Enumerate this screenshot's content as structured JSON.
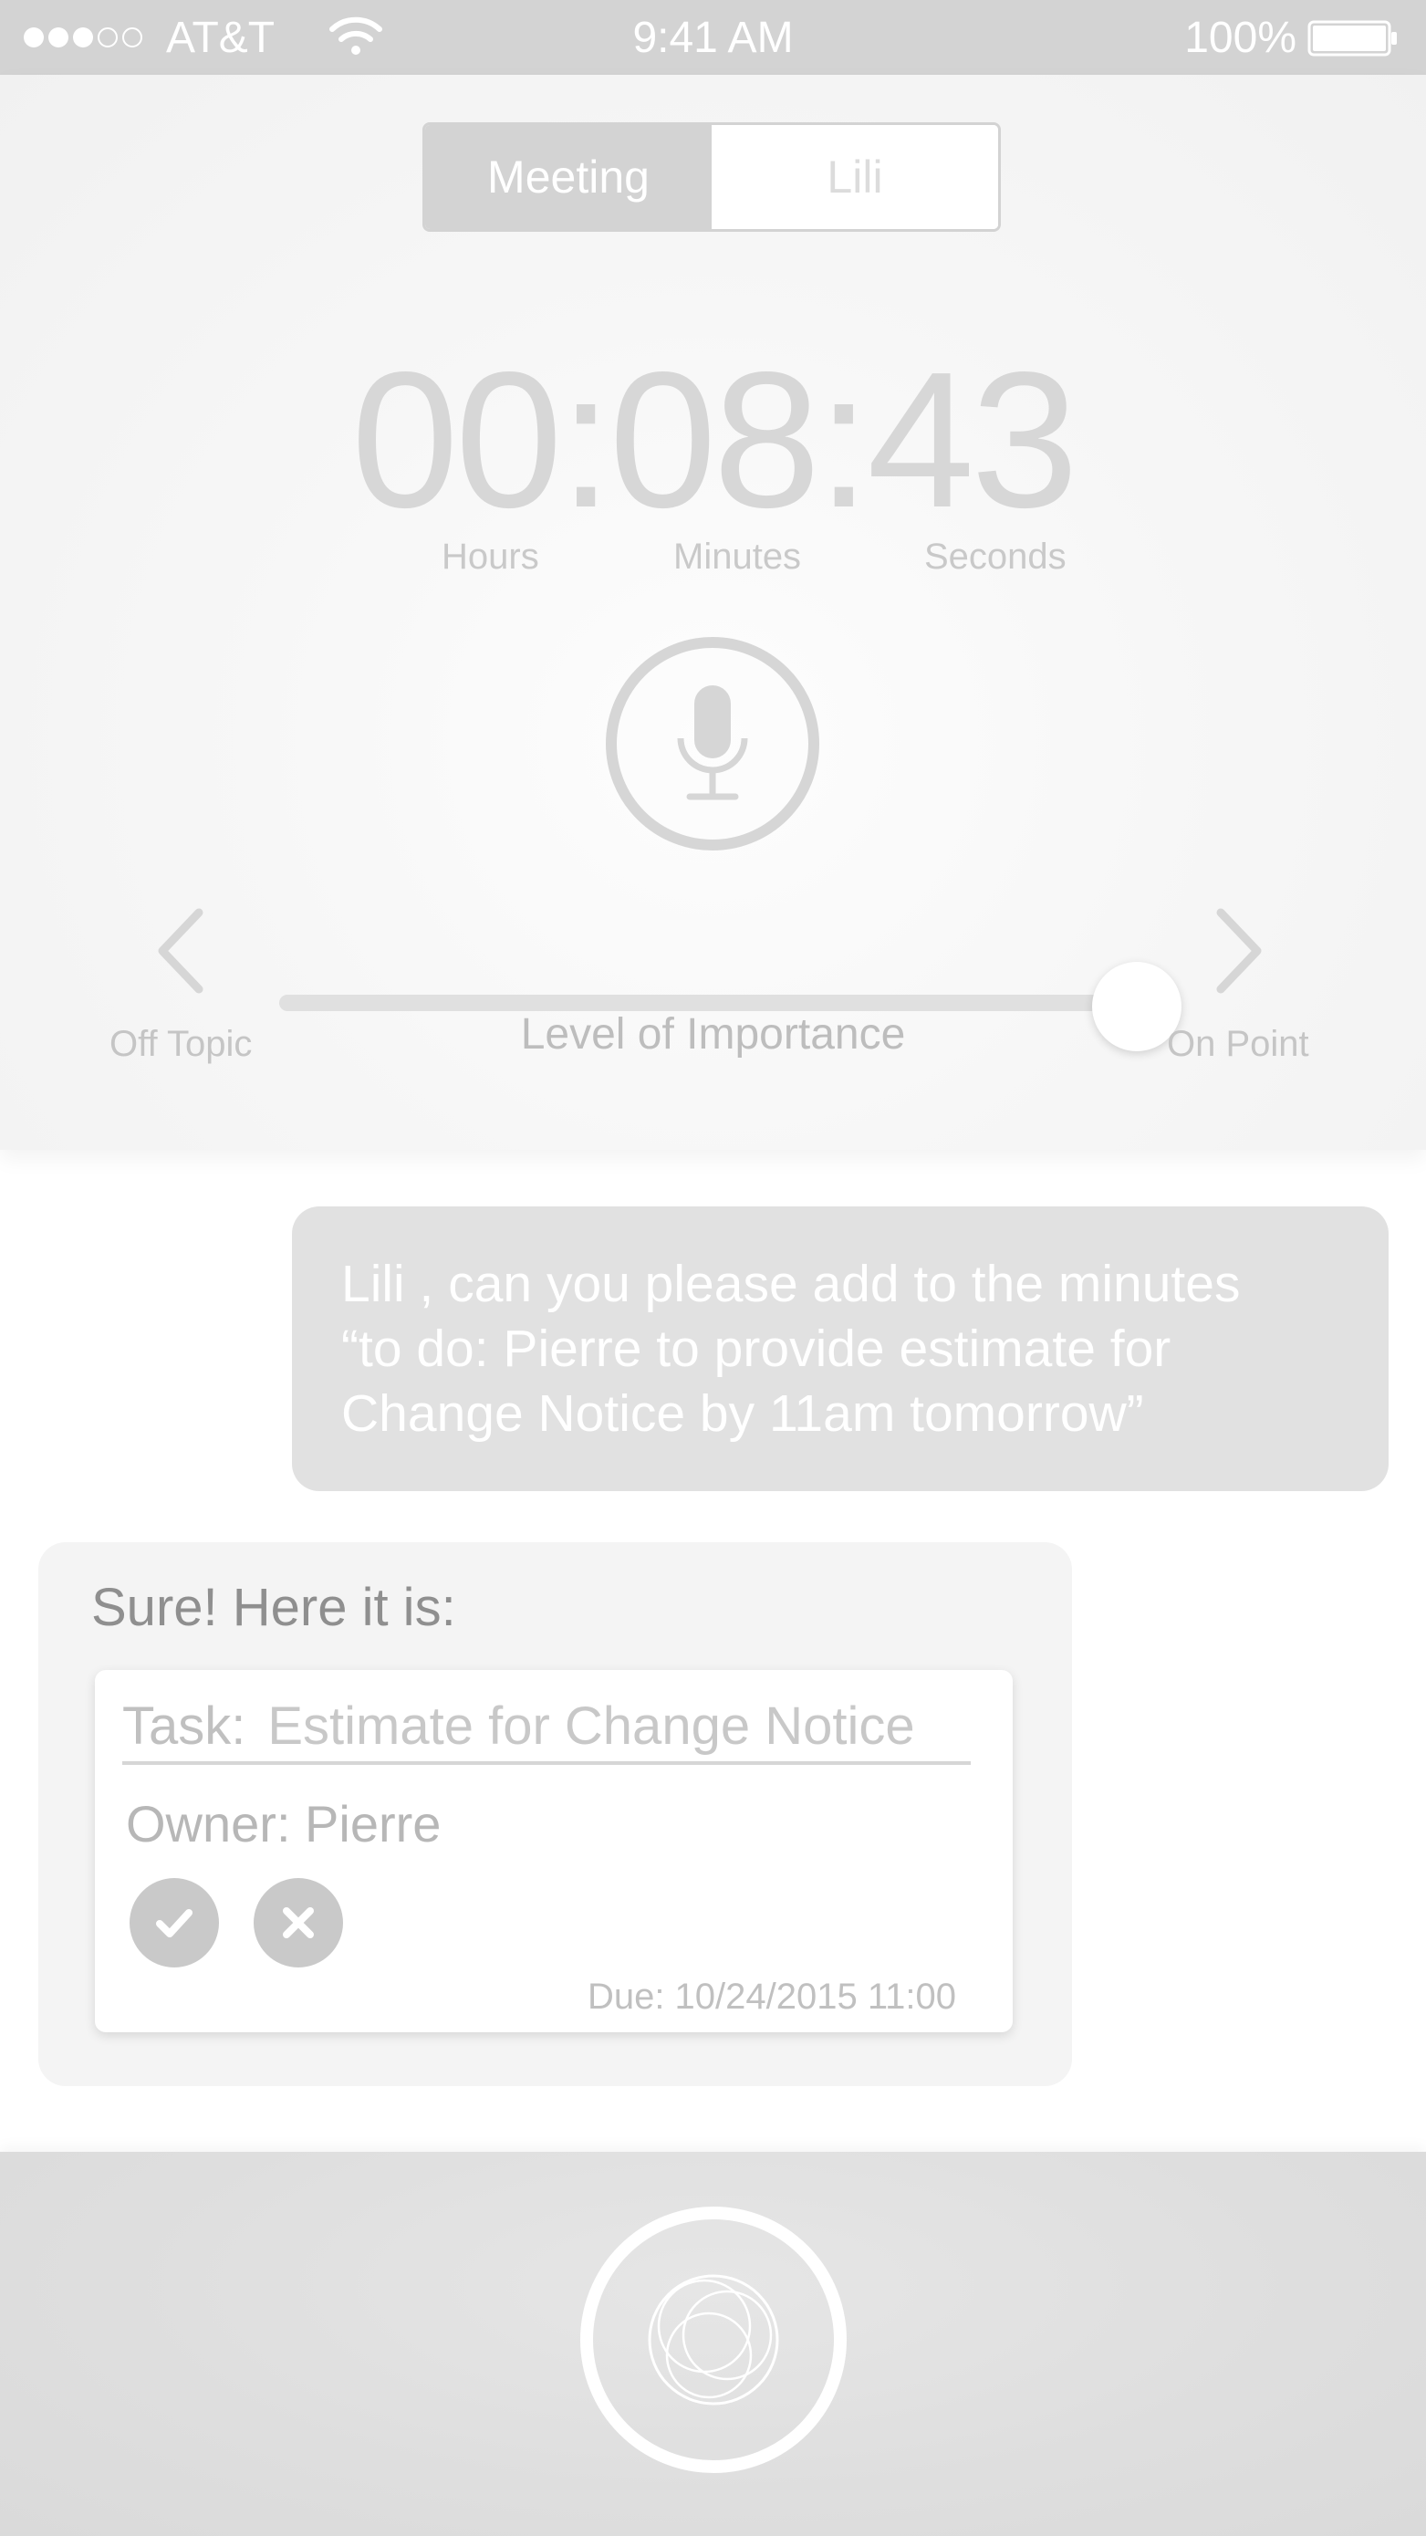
{
  "status_bar": {
    "signal_full": 3,
    "signal_empty": 2,
    "carrier": "AT&T",
    "time": "9:41 AM",
    "battery": "100%",
    "battery_level": 1.0
  },
  "mode_tabs": [
    {
      "label": "Meeting",
      "active": true
    },
    {
      "label": "Lili",
      "active": false
    }
  ],
  "timer": {
    "value": "00:08:43",
    "labels": {
      "hours": "Hours",
      "minutes": "Minutes",
      "seconds": "Seconds"
    }
  },
  "mic": {
    "icon": "microphone-icon"
  },
  "importance": {
    "title": "Level of Importance",
    "left_label": "Off Topic",
    "right_label": "On Point",
    "level": 1.0
  },
  "chat": {
    "user_message_lines": [
      "Lili , can you please add to the minutes",
      "“to do: Pierre to provide estimate for",
      "Change Notice by 11am tomorrow”"
    ],
    "bot_intro": "Sure! Here it is:",
    "task_card": {
      "task_label": "Task:",
      "task_value": "Estimate for Change Notice",
      "owner": "Owner: Pierre",
      "due": "Due: 10/24/2015 11:00",
      "accept_icon": "checkmark-icon",
      "reject_icon": "close-icon"
    }
  },
  "bottom_bar": {
    "assistant_icon": "assistant-rings-icon"
  },
  "colors": {
    "status_bar": "#d3d3d3",
    "accent_gray": "#d3d3d3",
    "bubble_user": "#e1e1e1",
    "bubble_bot": "#f4f4f4",
    "bottom_bar": "#dedede"
  }
}
